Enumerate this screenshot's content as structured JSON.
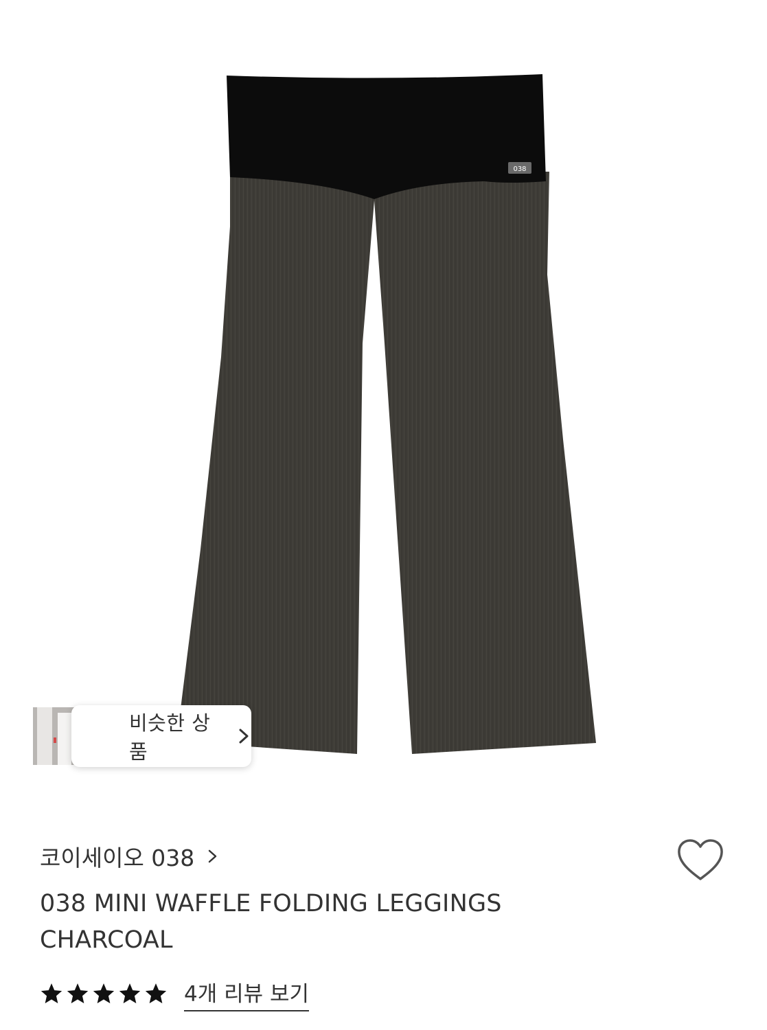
{
  "product_image": {
    "alt": "038 MINI WAFFLE FOLDING LEGGINGS CHARCOAL",
    "waistband_tag": "038",
    "colors": {
      "waistband": "#0c0c0c",
      "fabric": "#3e3c37"
    }
  },
  "similar_products": {
    "label": "비슷한 상품",
    "icon": "chevron-right-icon"
  },
  "brand": {
    "name": "코이세이오 038",
    "icon": "chevron-right-icon"
  },
  "wishlist": {
    "icon": "heart-outline-icon"
  },
  "product": {
    "title_line1": "038 MINI WAFFLE FOLDING LEGGINGS",
    "title_line2": "CHARCOAL"
  },
  "rating": {
    "stars": 5,
    "max_stars": 5,
    "review_link": "4개 리뷰 보기",
    "star_color": "#111111"
  }
}
